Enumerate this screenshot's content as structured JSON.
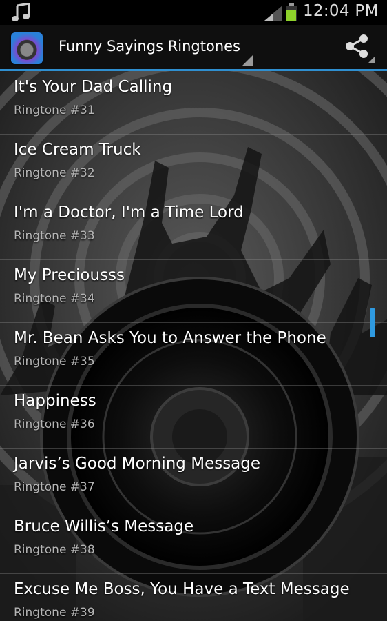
{
  "status_bar": {
    "time": "12:04 PM",
    "notification_icon": "music-note-icon",
    "signal_icon": "signal-icon",
    "battery_icon": "battery-icon",
    "battery_color": "#8ed22b"
  },
  "action_bar": {
    "title": "Funny Sayings Ringtones",
    "app_icon": "speaker-app-icon",
    "share_icon": "share-icon",
    "accent_color": "#2f8fd0"
  },
  "list": {
    "items": [
      {
        "name": "It's Your Dad Calling",
        "sub": "Ringtone #31"
      },
      {
        "name": "Ice Cream Truck",
        "sub": "Ringtone #32"
      },
      {
        "name": "I'm a Doctor, I'm a Time Lord",
        "sub": "Ringtone #33"
      },
      {
        "name": "My Preciousss",
        "sub": "Ringtone #34"
      },
      {
        "name": "Mr. Bean Asks You to Answer the Phone",
        "sub": "Ringtone #35"
      },
      {
        "name": "Happiness",
        "sub": "Ringtone #36"
      },
      {
        "name": "Jarvis’s Good Morning Message",
        "sub": "Ringtone #37"
      },
      {
        "name": "Bruce Willis’s Message",
        "sub": "Ringtone #38"
      },
      {
        "name": "Excuse Me Boss, You Have a Text Message",
        "sub": "Ringtone #39"
      }
    ],
    "scroll_position": 0.44,
    "scroll_color": "#2f9ae0"
  }
}
